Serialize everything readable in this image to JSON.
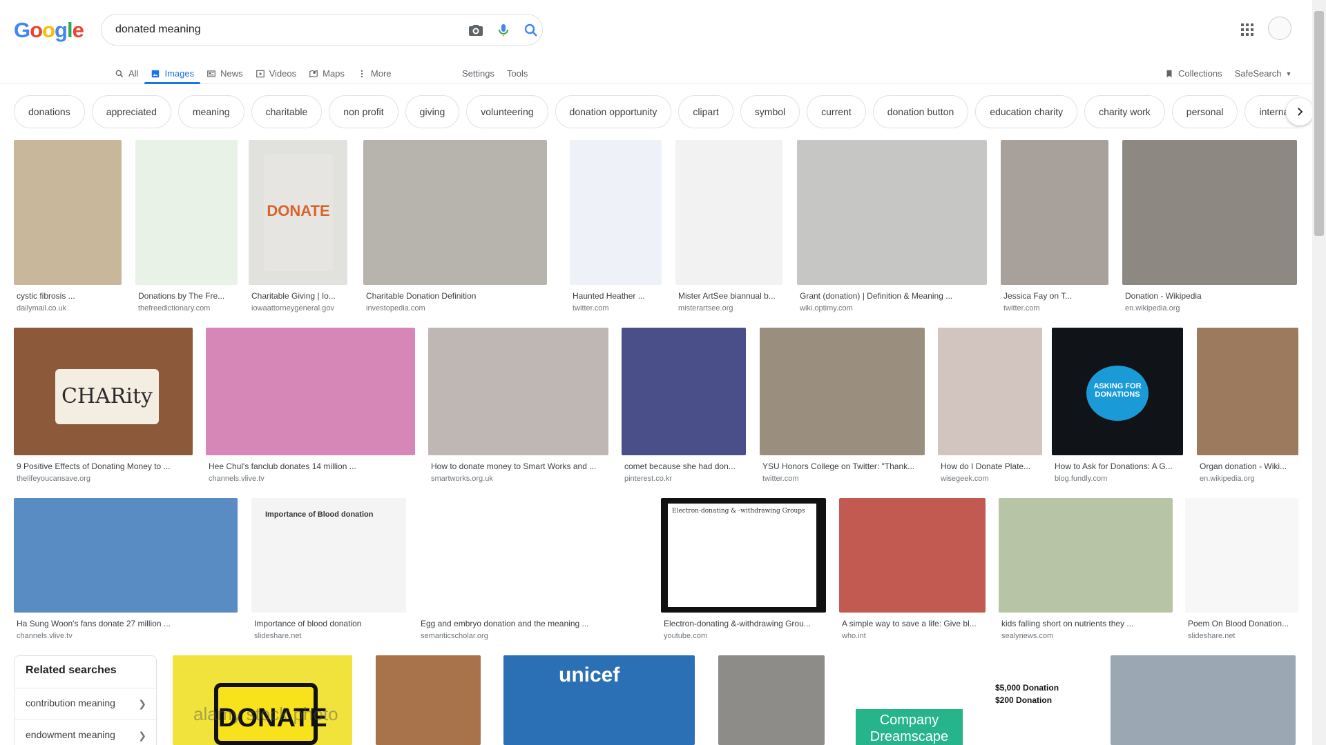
{
  "header": {
    "logo_letters": [
      {
        "ch": "G",
        "color": "#4285F4"
      },
      {
        "ch": "o",
        "color": "#EA4335"
      },
      {
        "ch": "o",
        "color": "#FBBC05"
      },
      {
        "ch": "g",
        "color": "#4285F4"
      },
      {
        "ch": "l",
        "color": "#34A853"
      },
      {
        "ch": "e",
        "color": "#EA4335"
      }
    ],
    "search_value": "donated meaning",
    "icons": [
      "camera-icon",
      "mic-icon",
      "search-icon",
      "apps-grid-icon"
    ]
  },
  "nav": {
    "tabs": [
      {
        "label": "All",
        "icon": "search-icon"
      },
      {
        "label": "Images",
        "icon": "image-icon",
        "active": true
      },
      {
        "label": "News",
        "icon": "news-icon"
      },
      {
        "label": "Videos",
        "icon": "video-icon"
      },
      {
        "label": "Maps",
        "icon": "map-icon"
      },
      {
        "label": "More",
        "icon": "more-vertical-icon"
      }
    ],
    "settings": "Settings",
    "tools": "Tools",
    "collections": "Collections",
    "safesearch": "SafeSearch"
  },
  "chips": [
    "donations",
    "appreciated",
    "meaning",
    "charitable",
    "non profit",
    "giving",
    "volunteering",
    "donation opportunity",
    "clipart",
    "symbol",
    "current",
    "donation button",
    "education charity",
    "charity work",
    "personal",
    "internationa"
  ],
  "results": [
    {
      "caption": "cystic fibrosis ...",
      "source": "dailymail.co.uk",
      "color": "#c9b79c"
    },
    {
      "caption": "Donations by The Fre...",
      "source": "thefreedictionary.com",
      "color": "#e8f2e6"
    },
    {
      "caption": "Charitable Giving | Io...",
      "source": "iowaattorneygeneral.gov",
      "color": "#e1e1de"
    },
    {
      "caption": "Charitable Donation Definition",
      "source": "investopedia.com",
      "color": "#b7b4ae"
    },
    {
      "caption": "Haunted Heather ...",
      "source": "twitter.com",
      "color": "#eef1f7"
    },
    {
      "caption": "Mister ArtSee biannual b...",
      "source": "misterartsee.org",
      "color": "#f2f2f2"
    },
    {
      "caption": "Grant (donation) | Definition & Meaning ...",
      "source": "wiki.optimy.com",
      "color": "#c6c6c4"
    },
    {
      "caption": "Jessica Fay on T...",
      "source": "twitter.com",
      "color": "#a8a09b"
    },
    {
      "caption": "Donation - Wikipedia",
      "source": "en.wikipedia.org",
      "color": "#8d8882"
    },
    {
      "caption": "9 Positive Effects of Donating Money to ...",
      "source": "thelifeyoucansave.org",
      "color": "#8c5a3a"
    },
    {
      "caption": "Hee Chul's fanclub donates 14 million ...",
      "source": "channels.vlive.tv",
      "color": "#d786b8"
    },
    {
      "caption": "How to donate money to Smart Works and ...",
      "source": "smartworks.org.uk",
      "color": "#bfb7b3"
    },
    {
      "caption": "comet because she had don...",
      "source": "pinterest.co.kr",
      "color": "#4a4f89"
    },
    {
      "caption": "YSU Honors College on Twitter: \"Thank...",
      "source": "twitter.com",
      "color": "#9a8f7f"
    },
    {
      "caption": "How do I Donate Plate...",
      "source": "wisegeek.com",
      "color": "#d2c5bf"
    },
    {
      "caption": "How to Ask for Donations: A G...",
      "source": "blog.fundly.com",
      "color": "#101418"
    },
    {
      "caption": "Organ donation - Wiki...",
      "source": "en.wikipedia.org",
      "color": "#9c7a5e"
    },
    {
      "caption": "Ha Sung Woon's fans donate 27 million ...",
      "source": "channels.vlive.tv",
      "color": "#5a8cc4"
    },
    {
      "caption": "Importance of blood donation",
      "source": "slideshare.net",
      "color": "#f4f4f4"
    },
    {
      "caption": "Egg and embryo donation and the meaning ...",
      "source": "semanticscholar.org",
      "color": "#ffffff"
    },
    {
      "caption": "Electron-donating &-withdrawing Grou...",
      "source": "youtube.com",
      "color": "#111111"
    },
    {
      "caption": "A simple way to save a life: Give bl...",
      "source": "who.int",
      "color": "#c25a52"
    },
    {
      "caption": "kids falling short on nutrients they ...",
      "source": "sealynews.com",
      "color": "#b8c4a6"
    },
    {
      "caption": "Poem On Blood Donation...",
      "source": "slideshare.net",
      "color": "#f7f7f7"
    },
    {
      "caption": "",
      "source": "",
      "color": "#f1e33b"
    },
    {
      "caption": "",
      "source": "",
      "color": "#a8724a"
    },
    {
      "caption": "",
      "source": "",
      "color": "#2b6fb4"
    },
    {
      "caption": "",
      "source": "",
      "color": "#8e8c89"
    },
    {
      "caption": "",
      "source": "",
      "color": "#ffffff"
    },
    {
      "caption": "",
      "source": "",
      "color": "#9ba8b4"
    }
  ],
  "thumb_text": {
    "donate_can": "DONATE",
    "charity_jar": "CHARity",
    "blood_title": "Importance of Blood donation",
    "asking_circle": "ASKING FOR DONATIONS",
    "unicef": "unicef",
    "company": "Company Dreamscape",
    "donation_line1": "$5,000 Donation",
    "donation_line2": "$200 Donation",
    "donate_sign": "DONATE",
    "watermark": "alamy stock photo",
    "electron_title": "Electron-donating & -withdrawing Groups"
  },
  "related": {
    "title": "Related searches",
    "items": [
      "contribution meaning",
      "endowment meaning"
    ]
  }
}
